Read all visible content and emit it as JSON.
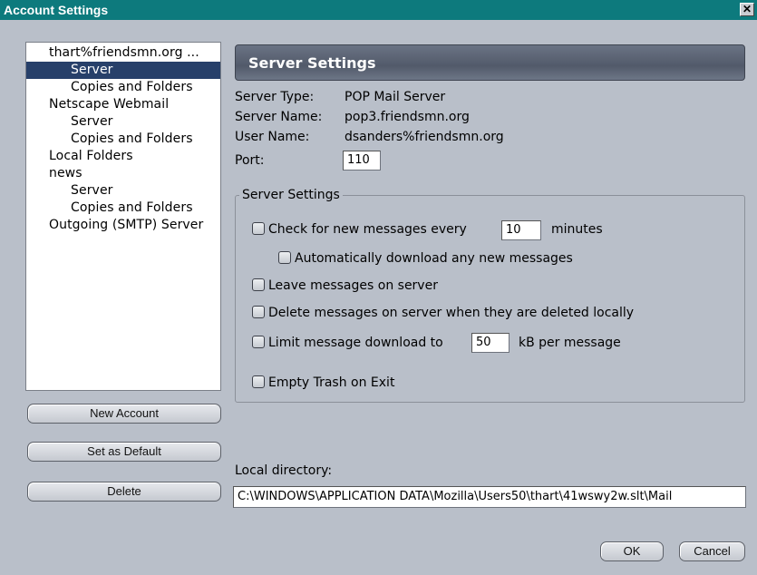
{
  "window": {
    "title": "Account Settings",
    "close_label": "✕"
  },
  "tree": {
    "items": [
      {
        "label": "thart%friendsmn.org ...",
        "level": 0,
        "selected": false
      },
      {
        "label": "Server",
        "level": 1,
        "selected": true
      },
      {
        "label": "Copies and Folders",
        "level": 1,
        "selected": false
      },
      {
        "label": "Netscape Webmail",
        "level": 0,
        "selected": false
      },
      {
        "label": "Server",
        "level": 1,
        "selected": false
      },
      {
        "label": "Copies and Folders",
        "level": 1,
        "selected": false
      },
      {
        "label": "Local Folders",
        "level": 0,
        "selected": false
      },
      {
        "label": "news",
        "level": 0,
        "selected": false
      },
      {
        "label": "Server",
        "level": 1,
        "selected": false
      },
      {
        "label": "Copies and Folders",
        "level": 1,
        "selected": false
      },
      {
        "label": "Outgoing (SMTP) Server",
        "level": 0,
        "selected": false
      }
    ]
  },
  "buttons": {
    "new_account": "New Account",
    "set_default": "Set as Default",
    "delete": "Delete",
    "ok": "OK",
    "cancel": "Cancel"
  },
  "panel": {
    "header": "Server Settings",
    "server_type_label": "Server Type:",
    "server_type_value": "POP Mail Server",
    "server_name_label": "Server Name:",
    "server_name_value": "pop3.friendsmn.org",
    "user_name_label": "User Name:",
    "user_name_value": "dsanders%friendsmn.org",
    "port_label": "Port:",
    "port_value": "110"
  },
  "settings_group": {
    "title": "Server Settings",
    "check_new_label": "Check for new messages every",
    "check_new_minutes": "10",
    "minutes_label": "minutes",
    "auto_download_label": "Automatically download any new messages",
    "leave_on_server_label": "Leave messages on server",
    "delete_on_server_label": "Delete messages on server when they are deleted locally",
    "limit_download_label": "Limit message download to",
    "limit_download_value": "50",
    "kb_label": "kB per message",
    "empty_trash_label": "Empty Trash on Exit"
  },
  "local_dir": {
    "label": "Local directory:",
    "value": "C:\\WINDOWS\\APPLICATION DATA\\Mozilla\\Users50\\thart\\41wswy2w.slt\\Mail"
  }
}
